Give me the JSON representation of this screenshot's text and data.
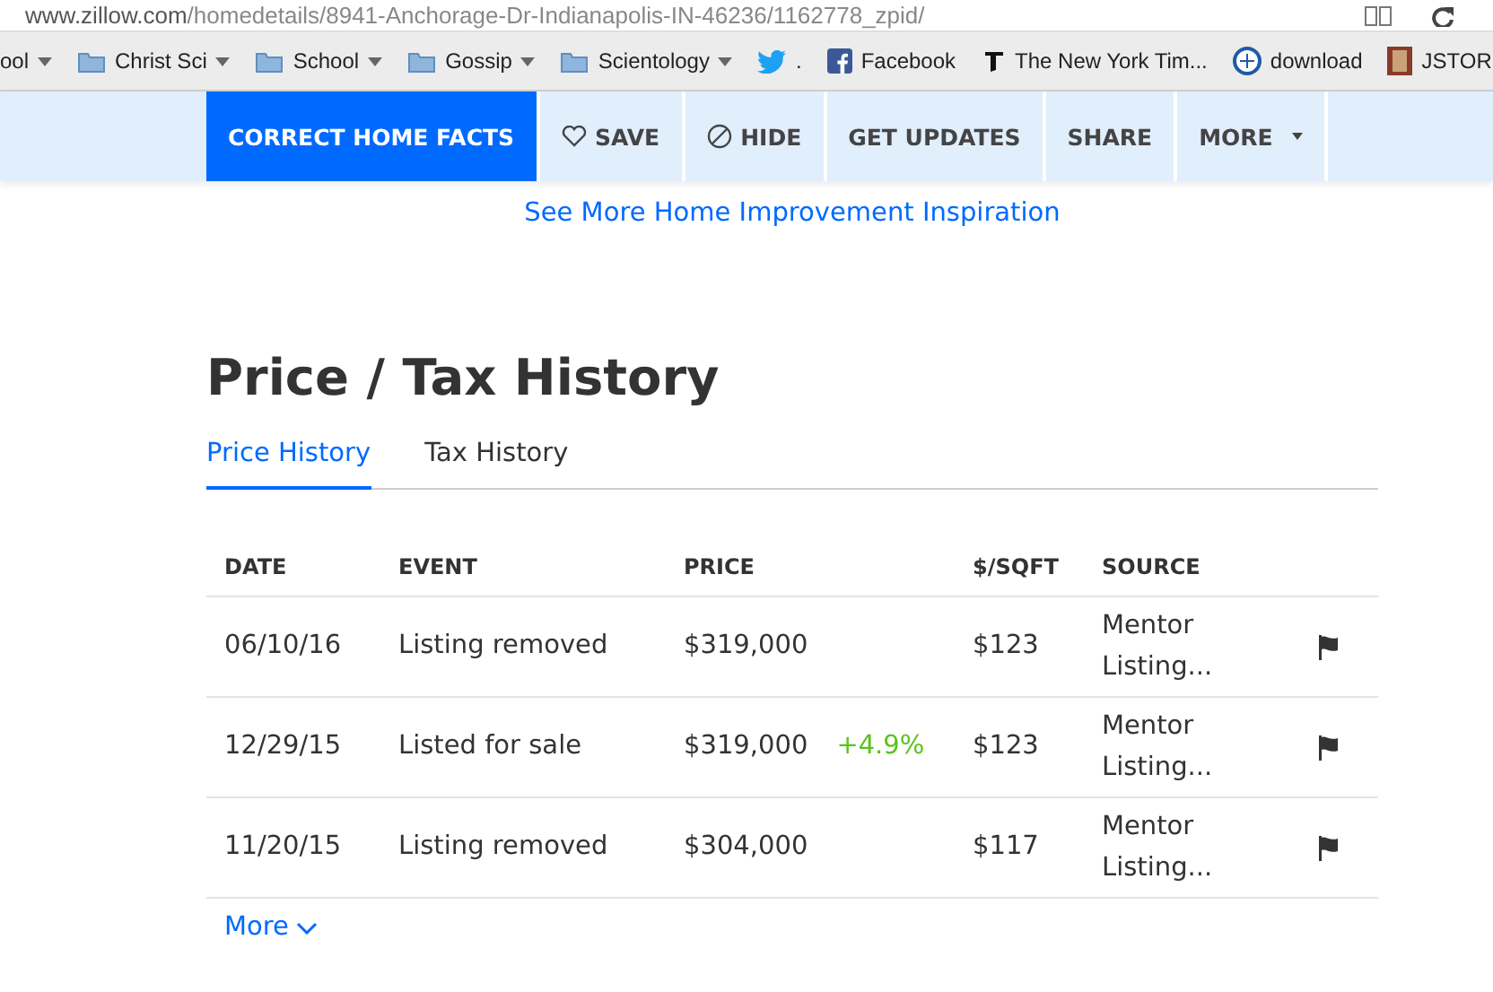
{
  "address_bar": {
    "url_host": "www.zillow.com",
    "url_path": "/homedetails/8941-Anchorage-Dr-Indianapolis-IN-46236/1162778_zpid/"
  },
  "bookmarks": [
    {
      "kind": "folder",
      "label": "ool"
    },
    {
      "kind": "folder",
      "label": "Christ Sci"
    },
    {
      "kind": "folder",
      "label": "School"
    },
    {
      "kind": "folder",
      "label": "Gossip"
    },
    {
      "kind": "folder",
      "label": "Scientology"
    },
    {
      "kind": "bird",
      "label": "."
    },
    {
      "kind": "facebook",
      "label": "Facebook"
    },
    {
      "kind": "newspaper",
      "label": "The New York Tim..."
    },
    {
      "kind": "globe",
      "label": "download"
    },
    {
      "kind": "journal",
      "label": "JSTOR"
    }
  ],
  "action_bar": [
    {
      "kind": "primary",
      "label": "CORRECT HOME FACTS"
    },
    {
      "kind": "heart",
      "label": "SAVE"
    },
    {
      "kind": "blocked",
      "label": "HIDE"
    },
    {
      "kind": "plain",
      "label": "GET UPDATES"
    },
    {
      "kind": "plain",
      "label": "SHARE"
    },
    {
      "kind": "menu",
      "label": "MORE"
    }
  ],
  "inspiration_link": "See More Home Improvement Inspiration",
  "section_title": "Price / Tax History",
  "tabs": [
    {
      "label": "Price History",
      "selected": true
    },
    {
      "label": "Tax History",
      "selected": false
    }
  ],
  "table": {
    "columns": [
      "DATE",
      "EVENT",
      "PRICE",
      "$/SQFT",
      "SOURCE"
    ],
    "rows": [
      {
        "date": "06/10/16",
        "event": "Listing removed",
        "price": "$319,000",
        "sqft": "$123",
        "source": "Mentor Listing..."
      },
      {
        "date": "12/29/15",
        "event": "Listed for sale",
        "price": "$319,000",
        "change": "+4.9%",
        "sqft": "$123",
        "source": "Mentor Listing..."
      },
      {
        "date": "11/20/15",
        "event": "Listing removed",
        "price": "$304,000",
        "sqft": "$117",
        "source": "Mentor Listing..."
      }
    ]
  },
  "more_link": "More"
}
